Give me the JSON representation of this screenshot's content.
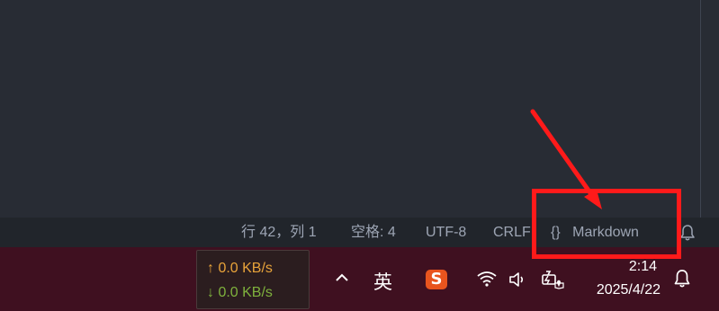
{
  "statusbar": {
    "position": "行 42，列 1",
    "indent": "空格: 4",
    "encoding": "UTF-8",
    "eol": "CRLF",
    "language_icon": "{}",
    "language": "Markdown",
    "notifications_icon": "bell-icon"
  },
  "taskbar": {
    "net_up": "↑ 0.0 KB/s",
    "net_down": "↓ 0.0 KB/s",
    "ime_label": "英",
    "sogou_label": "S",
    "time": "2:14",
    "date": "2025/4/22"
  },
  "colors": {
    "editor_bg": "#282c34",
    "statusbar_bg": "#21252b",
    "taskbar_bg": "#3f1020",
    "net_up": "#e8a33a",
    "net_down": "#7fb23d",
    "annotation": "#ff1a1a"
  }
}
